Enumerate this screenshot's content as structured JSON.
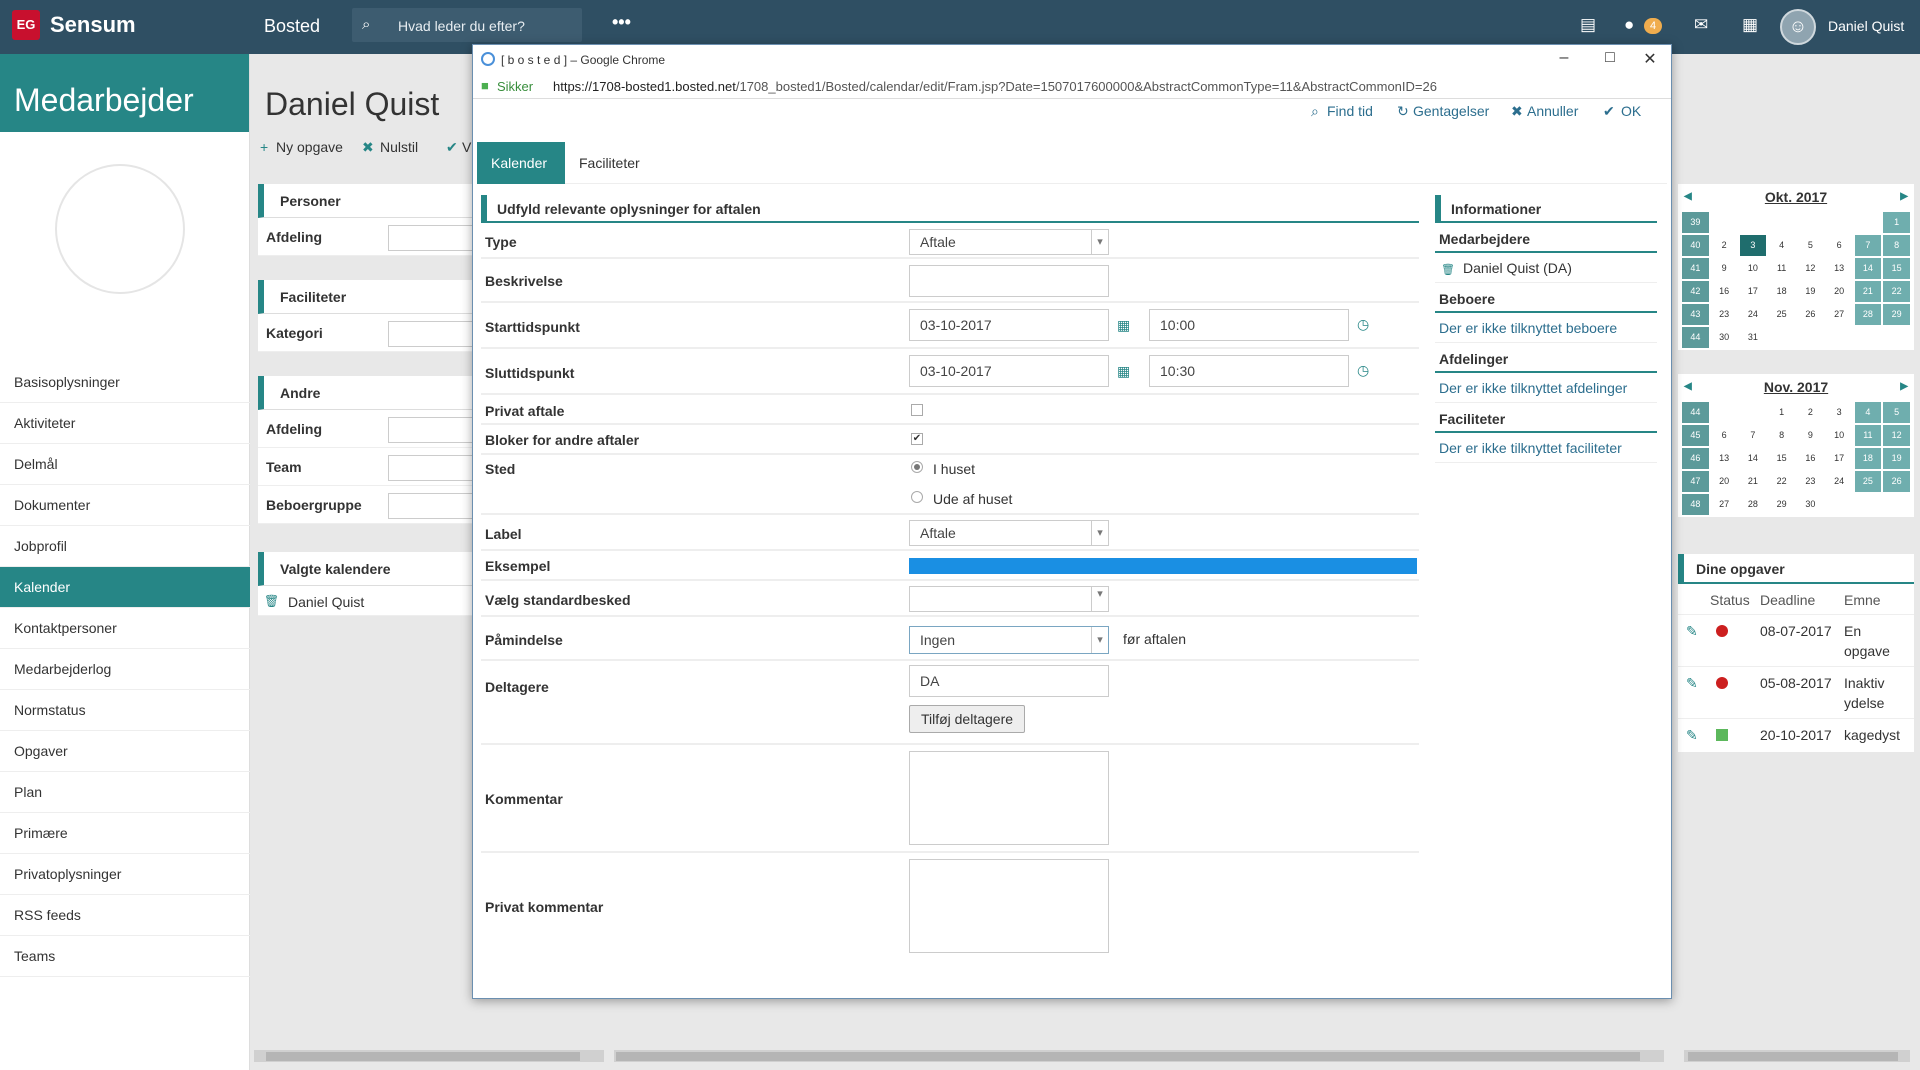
{
  "topbar": {
    "brand": "Sensum",
    "context": "Bosted",
    "search_placeholder": "Hvad leder du efter?",
    "more": "•••",
    "chat_badge": "4",
    "username": "Daniel Quist"
  },
  "sidebar": {
    "title": "Medarbejder",
    "items": [
      {
        "label": "Basisoplysninger"
      },
      {
        "label": "Aktiviteter"
      },
      {
        "label": "Delmål"
      },
      {
        "label": "Dokumenter"
      },
      {
        "label": "Jobprofil"
      },
      {
        "label": "Kalender",
        "active": true
      },
      {
        "label": "Kontaktpersoner"
      },
      {
        "label": "Medarbejderlog"
      },
      {
        "label": "Normstatus"
      },
      {
        "label": "Opgaver"
      },
      {
        "label": "Plan"
      },
      {
        "label": "Primære"
      },
      {
        "label": "Privatoplysninger"
      },
      {
        "label": "RSS feeds"
      },
      {
        "label": "Teams"
      }
    ]
  },
  "main": {
    "title": "Daniel Quist",
    "toolbar": {
      "new_task": "Ny opgave",
      "reset": "Nulstil",
      "partial": "Vi"
    },
    "panels": {
      "personer": {
        "title": "Personer",
        "afdeling": "Afdeling"
      },
      "faciliteter": {
        "title": "Faciliteter",
        "kategori": "Kategori"
      },
      "andre": {
        "title": "Andre",
        "afdeling": "Afdeling",
        "team": "Team",
        "beboergruppe": "Beboergruppe"
      },
      "valgte": {
        "title": "Valgte kalendere",
        "item": "Daniel Quist"
      }
    }
  },
  "popup": {
    "window_title": "[ b o s t e d ] – Google Chrome",
    "secure_label": "Sikker",
    "url_host": "https://1708-bosted1.bosted.net",
    "url_path": "/1708_bosted1/Bosted/calendar/edit/Fram.jsp?Date=1507017600000&AbstractCommonType=11&AbstractCommonID=26",
    "actions": {
      "find_tid": "Find tid",
      "gentagelser": "Gentagelser",
      "annuller": "Annuller",
      "ok": "OK"
    },
    "tabs": {
      "kalender": "Kalender",
      "faciliteter": "Faciliteter"
    },
    "form": {
      "heading": "Udfyld relevante oplysninger for aftalen",
      "type_label": "Type",
      "type_value": "Aftale",
      "beskrivelse_label": "Beskrivelse",
      "start_label": "Starttidspunkt",
      "start_date": "03-10-2017",
      "start_time": "10:00",
      "slut_label": "Sluttidspunkt",
      "slut_date": "03-10-2017",
      "slut_time": "10:30",
      "privat_label": "Privat aftale",
      "bloker_label": "Bloker for andre aftaler",
      "sted_label": "Sted",
      "sted_opt1": "I huset",
      "sted_opt2": "Ude af huset",
      "label_label": "Label",
      "label_value": "Aftale",
      "eksempel_label": "Eksempel",
      "eksempel_color": "#1a8fe3",
      "standard_label": "Vælg standardbesked",
      "paamindelse_label": "Påmindelse",
      "paamindelse_value": "Ingen",
      "paamindelse_suffix": "før aftalen",
      "deltagere_label": "Deltagere",
      "deltagere_value": "DA",
      "add_btn": "Tilføj deltagere",
      "kommentar_label": "Kommentar",
      "privat_kommentar_label": "Privat kommentar"
    },
    "info": {
      "title": "Informationer",
      "medarbejdere": "Medarbejdere",
      "medarbejder_item": "Daniel Quist (DA)",
      "beboere": "Beboere",
      "beboere_item": "Der er ikke tilknyttet beboere",
      "afdelinger": "Afdelinger",
      "afdelinger_item": "Der er ikke tilknyttet afdelinger",
      "faciliteter": "Faciliteter",
      "faciliteter_item": "Der er ikke tilknyttet faciliteter"
    }
  },
  "calendars": [
    {
      "month": "Okt. 2017",
      "weeks": [
        [
          "39",
          "",
          "",
          "",
          "",
          "",
          "",
          "1"
        ],
        [
          "40",
          "2",
          "3",
          "4",
          "5",
          "6",
          "7",
          "8"
        ],
        [
          "41",
          "9",
          "10",
          "11",
          "12",
          "13",
          "14",
          "15"
        ],
        [
          "42",
          "16",
          "17",
          "18",
          "19",
          "20",
          "21",
          "22"
        ],
        [
          "43",
          "23",
          "24",
          "25",
          "26",
          "27",
          "28",
          "29"
        ],
        [
          "44",
          "30",
          "31",
          "",
          "",
          "",
          "",
          ""
        ]
      ],
      "today": "3"
    },
    {
      "month": "Nov. 2017",
      "weeks": [
        [
          "44",
          "",
          "",
          "1",
          "2",
          "3",
          "4",
          "5"
        ],
        [
          "45",
          "6",
          "7",
          "8",
          "9",
          "10",
          "11",
          "12"
        ],
        [
          "46",
          "13",
          "14",
          "15",
          "16",
          "17",
          "18",
          "19"
        ],
        [
          "47",
          "20",
          "21",
          "22",
          "23",
          "24",
          "25",
          "26"
        ],
        [
          "48",
          "27",
          "28",
          "29",
          "30",
          "",
          "",
          ""
        ]
      ],
      "today": ""
    }
  ],
  "tasks": {
    "title": "Dine opgaver",
    "col_status": "Status",
    "col_deadline": "Deadline",
    "col_emne": "Emne",
    "rows": [
      {
        "deadline": "08-07-2017",
        "emne1": "En",
        "emne2": "opgave",
        "status": "red"
      },
      {
        "deadline": "05-08-2017",
        "emne1": "Inaktiv",
        "emne2": "ydelse",
        "status": "red"
      },
      {
        "deadline": "20-10-2017",
        "emne1": "kagedyst",
        "emne2": "",
        "status": "green"
      }
    ]
  }
}
